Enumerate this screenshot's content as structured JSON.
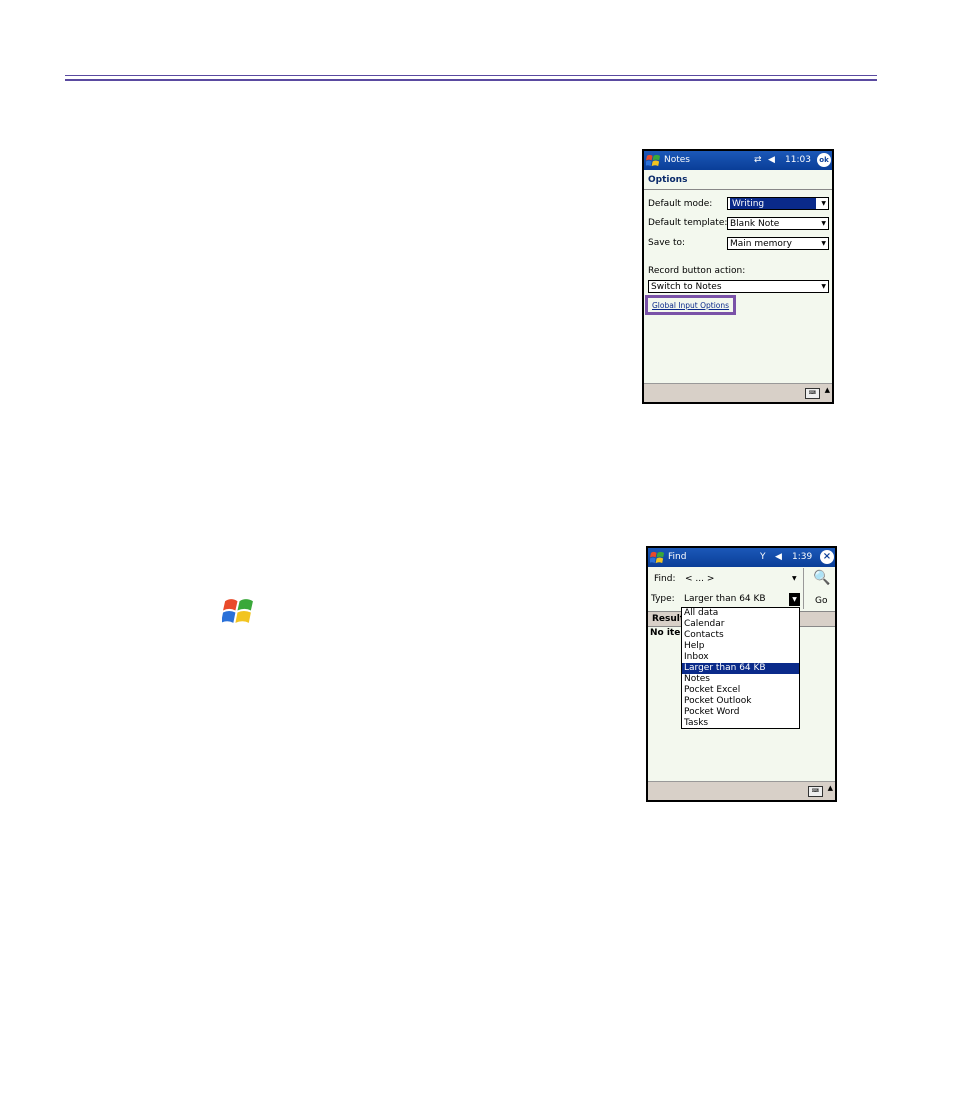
{
  "notes_screen": {
    "title": "Notes",
    "status": "11:03",
    "ok_label": "ok",
    "section": "Options",
    "default_mode_label": "Default mode:",
    "default_mode_value": "Writing",
    "default_template_label": "Default template:",
    "default_template_value": "Blank Note",
    "save_to_label": "Save to:",
    "save_to_value": "Main memory",
    "record_label": "Record button action:",
    "record_value": "Switch to Notes",
    "global_input_link": "Global Input Options"
  },
  "find_screen": {
    "title": "Find",
    "status": "1:39",
    "find_label": "Find:",
    "find_value": "< ... >",
    "type_label": "Type:",
    "type_value": "Larger than 64 KB",
    "go_label": "Go",
    "results_label": "Result",
    "no_items": "No item",
    "list_items": [
      "All data",
      "Calendar",
      "Contacts",
      "Help",
      "Inbox",
      "Larger than 64 KB",
      "Notes",
      "Pocket Excel",
      "Pocket Outlook",
      "Pocket Word",
      "Tasks"
    ],
    "selected_index": 5
  },
  "colors": {
    "rule": "#5a4aa0",
    "title_bar": "#0a3e98",
    "highlight": "#7a52a8",
    "selection": "#0a2a8a"
  }
}
